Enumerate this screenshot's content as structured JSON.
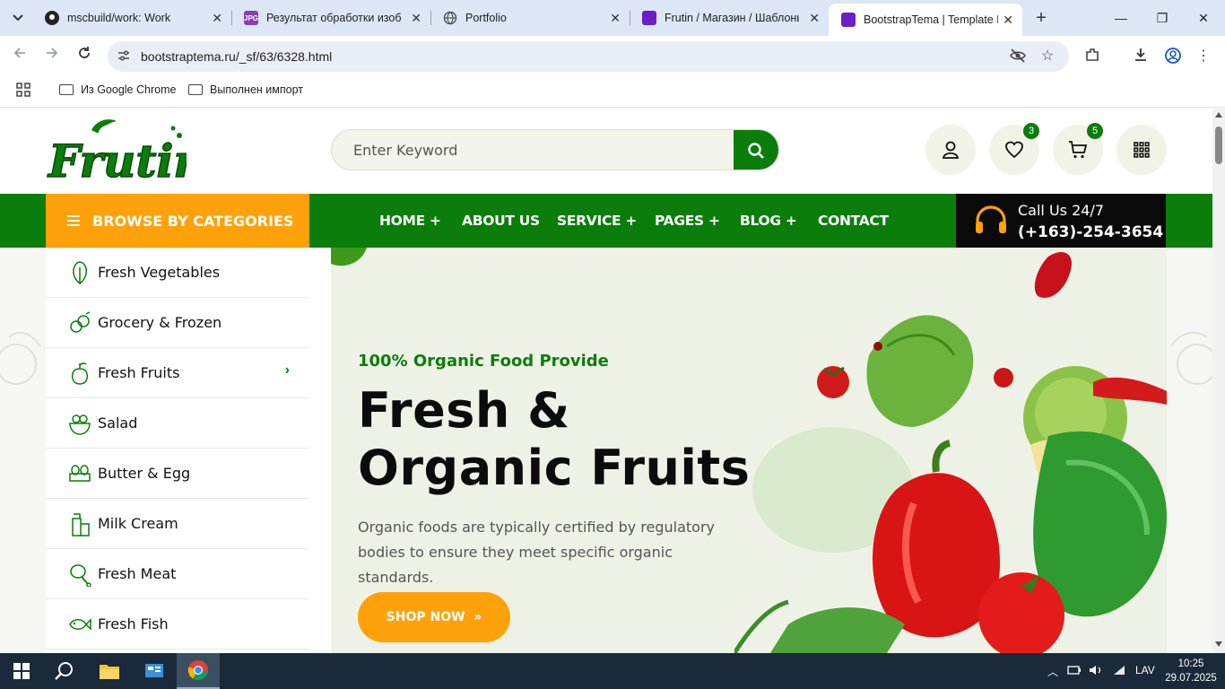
{
  "browser": {
    "tabs": [
      {
        "title": "mscbuild/work: Work",
        "icon": "github-icon"
      },
      {
        "title": "Результат обработки изобр",
        "icon": "jpg-icon",
        "icon_text": "JPG"
      },
      {
        "title": "Portfolio",
        "icon": "globe-icon"
      },
      {
        "title": "Frutin / Магазин / Шаблоны",
        "icon": "bootstrap-icon"
      },
      {
        "title": "BootstrapTema | Template Bo",
        "icon": "bootstrap-icon"
      }
    ],
    "url": "bootstraptema.ru/_sf/63/6328.html",
    "bookmarks": [
      {
        "label": "Из Google Chrome"
      },
      {
        "label": "Выполнен импорт"
      }
    ]
  },
  "site": {
    "logo_text": "Frutin",
    "search": {
      "placeholder": "Enter Keyword"
    },
    "header_icons": [
      {
        "name": "user-icon"
      },
      {
        "name": "heart-icon",
        "count": "3"
      },
      {
        "name": "cart-icon",
        "count": "5"
      },
      {
        "name": "grid-icon"
      }
    ],
    "browse_label": "BROWSE BY CATEGORIES",
    "nav": [
      {
        "label": "HOME +"
      },
      {
        "label": "ABOUT US"
      },
      {
        "label": "SERVICE +"
      },
      {
        "label": "PAGES +"
      },
      {
        "label": "BLOG +"
      },
      {
        "label": "CONTACT"
      }
    ],
    "call": {
      "line1": "Call Us 24/7",
      "line2": "(+163)-254-3654"
    },
    "categories": [
      {
        "label": "Fresh Vegetables",
        "icon": "vegetable-icon"
      },
      {
        "label": "Grocery & Frozen",
        "icon": "grocery-icon"
      },
      {
        "label": "Fresh Fruits",
        "icon": "fruit-icon",
        "has_submenu": true
      },
      {
        "label": "Salad",
        "icon": "salad-icon"
      },
      {
        "label": "Butter & Egg",
        "icon": "egg-icon"
      },
      {
        "label": "Milk Cream",
        "icon": "milk-icon"
      },
      {
        "label": "Fresh Meat",
        "icon": "meat-icon"
      },
      {
        "label": "Fresh Fish",
        "icon": "fish-icon"
      }
    ],
    "hero": {
      "eyebrow": "100% Organic Food Provide",
      "title": "Fresh & Organic Fruits",
      "description": "Organic foods are typically certified by regulatory bodies to ensure they meet specific organic standards.",
      "cta": "SHOP NOW"
    },
    "colors": {
      "green": "#0b7d0b",
      "orange": "#ffa10a",
      "dark": "#0a0a0a"
    }
  },
  "taskbar": {
    "lang": "LAV",
    "time": "10:25",
    "date": "29.07.2025"
  }
}
